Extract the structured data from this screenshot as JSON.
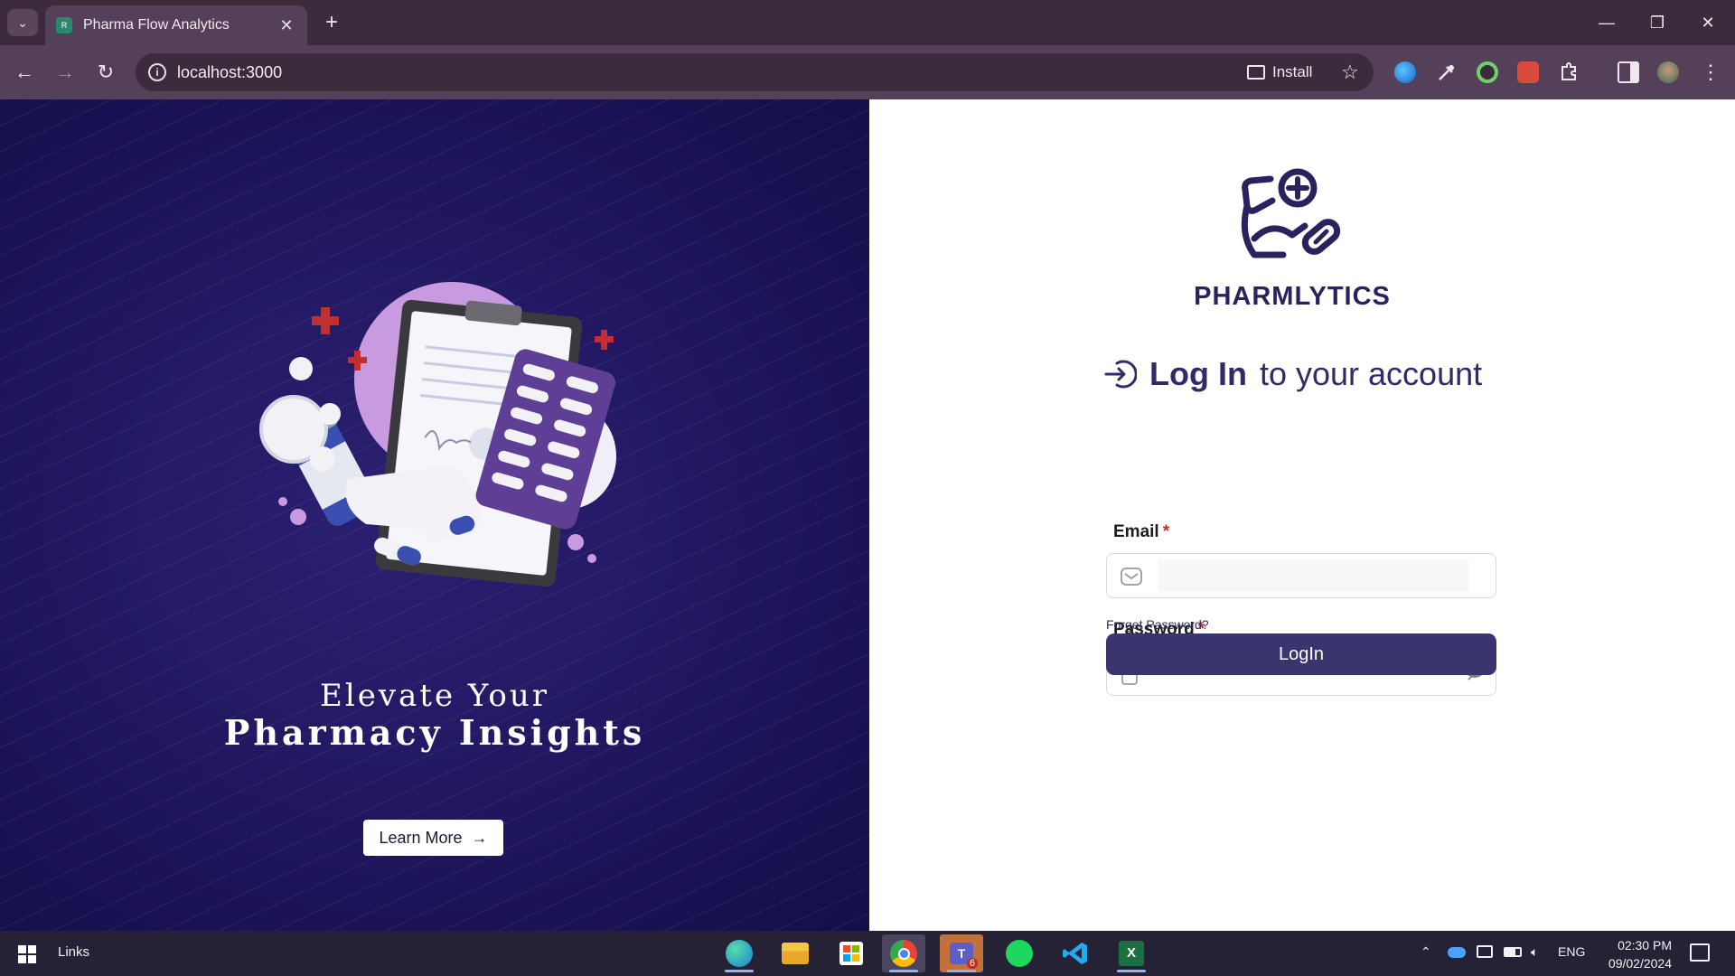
{
  "browser": {
    "tab_title": "Pharma Flow Analytics",
    "url": "localhost:3000",
    "install_label": "Install"
  },
  "hero": {
    "line1": "Elevate Your",
    "line2": "Pharmacy Insights",
    "learn_more_label": "Learn More"
  },
  "login": {
    "brand": "PHARMLYTICS",
    "heading_strong": "Log In",
    "heading_rest": "to your account",
    "email_label": "Email",
    "password_label": "Password",
    "required_mark": "*",
    "email_value": "",
    "password_value": "",
    "forgot_label": "Forget Password?",
    "login_label": "LogIn"
  },
  "taskbar": {
    "links_label": "Links",
    "language": "ENG",
    "time": "02:30 PM",
    "date": "09/02/2024",
    "teams_badge": "6"
  },
  "colors": {
    "hero_bg": "#1f1660",
    "primary": "#3a346f",
    "brand_text": "#28235e",
    "required": "#d8232a"
  }
}
